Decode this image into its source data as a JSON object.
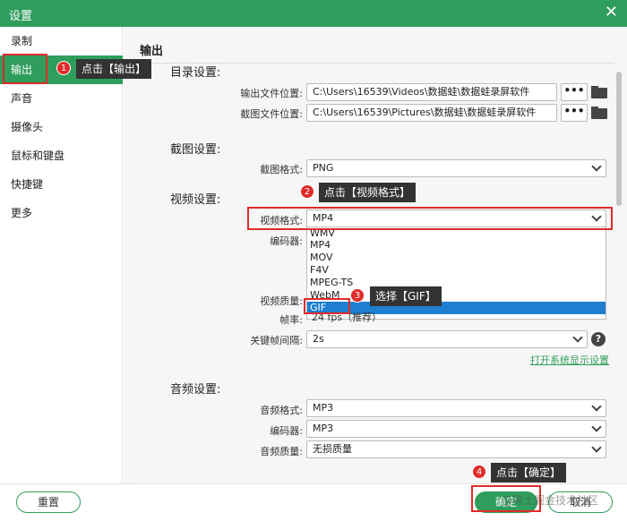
{
  "window": {
    "title": "设置",
    "close_icon": "close-icon"
  },
  "sidebar": {
    "items": [
      {
        "label": "录制"
      },
      {
        "label": "输出"
      },
      {
        "label": "声音"
      },
      {
        "label": "摄像头"
      },
      {
        "label": "鼠标和键盘"
      },
      {
        "label": "快捷键"
      },
      {
        "label": "更多"
      }
    ],
    "active_index": 1
  },
  "main": {
    "section_title": "输出",
    "directory": {
      "heading": "目录设置:",
      "output_label": "输出文件位置:",
      "output_path": "C:\\Users\\16539\\Videos\\数据蛙\\数据蛙录屏软件",
      "screenshot_label": "截图文件位置:",
      "screenshot_path": "C:\\Users\\16539\\Pictures\\数据蛙\\数据蛙录屏软件",
      "browse_label": "•••"
    },
    "screenshot": {
      "heading": "截图设置:",
      "format_label": "截图格式:",
      "format_value": "PNG"
    },
    "video": {
      "heading": "视频设置:",
      "format_label": "视频格式:",
      "format_value": "MP4",
      "encoder_label": "编码器:",
      "quality_label": "视频质量:",
      "fps_label": "帧率:",
      "fps_value": "24 fps（推荐）",
      "keyframe_label": "关键帧间隔:",
      "keyframe_value": "2s",
      "help_label": "?",
      "display_link": "打开系统显示设置",
      "options": [
        "WMV",
        "MP4",
        "MOV",
        "F4V",
        "MPEG-TS",
        "WebM",
        "GIF"
      ],
      "highlighted_option": "GIF"
    },
    "audio": {
      "heading": "音频设置:",
      "format_label": "音频格式:",
      "format_value": "MP3",
      "encoder_label": "编码器:",
      "encoder_value": "MP3",
      "quality_label": "音频质量:",
      "quality_value": "无损质量"
    }
  },
  "footer": {
    "reset_label": "重置",
    "ok_label": "确定",
    "cancel_label": "取消"
  },
  "annotations": {
    "step1": {
      "num": "1",
      "text": "点击【输出】"
    },
    "step2": {
      "num": "2",
      "text": "点击【视频格式】"
    },
    "step3": {
      "num": "3",
      "text": "选择【GIF】"
    },
    "step4": {
      "num": "4",
      "text": "点击【确定】"
    }
  },
  "watermark": "@稀土掘金技术社区",
  "colors": {
    "accent": "#2f9e5d",
    "highlight": "#e02b2b",
    "selection": "#1e7fd1"
  }
}
